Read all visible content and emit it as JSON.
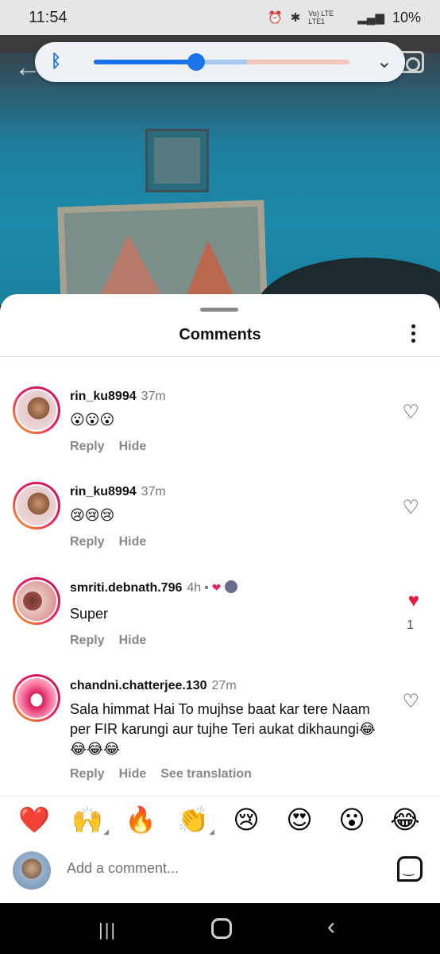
{
  "status_bar": {
    "time": "11:54",
    "alarm_icon": "alarm-icon",
    "bluetooth_icon": "bluetooth-icon",
    "network": "Vo) LTE LTE1",
    "signal_icon": "signal-icon",
    "battery": "10%"
  },
  "volume_panel": {
    "icon": "bluetooth-icon",
    "level": 0.4,
    "accent": "#1a73e8",
    "expand_icon": "chevron-down-icon"
  },
  "sheet": {
    "title": "Comments",
    "more_icon": "more-vertical-icon"
  },
  "comments": [
    {
      "username": "rin_ku8994",
      "time": "37m",
      "text": "😮😮😮",
      "actions": [
        "Reply",
        "Hide"
      ],
      "liked": false,
      "like_count": ""
    },
    {
      "username": "rin_ku8994",
      "time": "37m",
      "text": "😢😢😢",
      "actions": [
        "Reply",
        "Hide"
      ],
      "liked": false,
      "like_count": ""
    },
    {
      "username": "smriti.debnath.796",
      "time": "4h",
      "dot": "•",
      "author_heart": "❤",
      "text": "Super",
      "actions": [
        "Reply",
        "Hide"
      ],
      "liked": true,
      "like_count": "1"
    },
    {
      "username": "chandni.chatterjee.130",
      "time": "27m",
      "text": "Sala himmat Hai To mujhse baat kar tere Naam per FIR karungi aur tujhe Teri aukat dikhaungi😂😂😂😂",
      "actions": [
        "Reply",
        "Hide",
        "See translation"
      ],
      "liked": false,
      "like_count": ""
    }
  ],
  "reactions": [
    "❤️",
    "🙌",
    "🔥",
    "👏",
    "😢",
    "😍",
    "😮",
    "😂"
  ],
  "composer": {
    "placeholder": "Add a comment...",
    "sticker_icon": "sticker-icon"
  },
  "nav": {
    "recent": "|||",
    "back": "‹"
  },
  "colors": {
    "like_red": "#e41e3f",
    "story_ring": "#e91e63"
  }
}
